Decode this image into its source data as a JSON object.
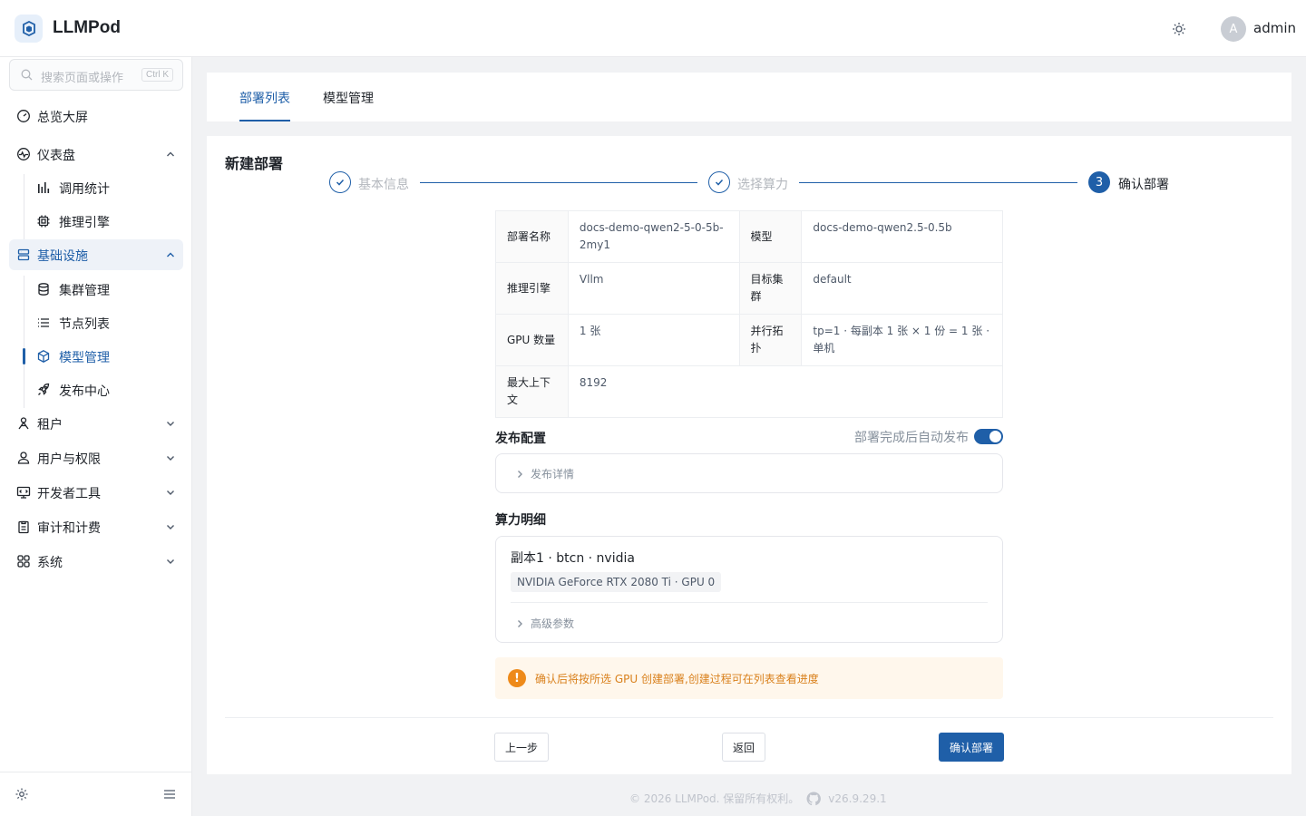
{
  "app": {
    "name": "LLMPod"
  },
  "header": {
    "username": "admin",
    "avatar_letter": "A"
  },
  "sidebar": {
    "search_placeholder": "搜索页面或操作",
    "search_shortcut": "Ctrl K",
    "items": [
      {
        "label": "总览大屏",
        "icon": "dashboard-gauge-icon"
      },
      {
        "label": "仪表盘",
        "icon": "pulse-icon",
        "expanded": true,
        "children": [
          {
            "label": "调用统计",
            "icon": "bar-chart-icon"
          },
          {
            "label": "推理引擎",
            "icon": "chip-icon"
          }
        ]
      },
      {
        "label": "基础设施",
        "icon": "server-icon",
        "expanded": true,
        "active": true,
        "children": [
          {
            "label": "集群管理",
            "icon": "database-icon"
          },
          {
            "label": "节点列表",
            "icon": "list-icon"
          },
          {
            "label": "模型管理",
            "icon": "cube-icon",
            "active": true
          },
          {
            "label": "发布中心",
            "icon": "rocket-icon"
          }
        ]
      },
      {
        "label": "租户",
        "icon": "tenant-icon"
      },
      {
        "label": "用户与权限",
        "icon": "user-icon"
      },
      {
        "label": "开发者工具",
        "icon": "code-window-icon"
      },
      {
        "label": "审计和计费",
        "icon": "clipboard-icon"
      },
      {
        "label": "系统",
        "icon": "apps-grid-icon"
      }
    ]
  },
  "tabs": [
    {
      "label": "部署列表",
      "active": true
    },
    {
      "label": "模型管理",
      "active": false
    }
  ],
  "page": {
    "title": "新建部署"
  },
  "steps": [
    {
      "label": "基本信息",
      "status": "done"
    },
    {
      "label": "选择算力",
      "status": "done"
    },
    {
      "label": "确认部署",
      "status": "current",
      "number": "3"
    }
  ],
  "summary": {
    "deploy_name_label": "部署名称",
    "deploy_name": "docs-demo-qwen2-5-0-5b-2my1",
    "model_label": "模型",
    "model": "docs-demo-qwen2.5-0.5b",
    "engine_label": "推理引擎",
    "engine": "Vllm",
    "cluster_label": "目标集群",
    "cluster": "default",
    "gpu_count_label": "GPU 数量",
    "gpu_count": "1 张",
    "topology_label": "并行拓扑",
    "topology": "tp=1 · 每副本 1 张 × 1 份 = 1 张 · 单机",
    "max_context_label": "最大上下文",
    "max_context": "8192"
  },
  "publish": {
    "title": "发布配置",
    "auto_publish_label": "部署完成后自动发布",
    "auto_publish": true,
    "details_label": "发布详情"
  },
  "compute": {
    "title": "算力明细",
    "replica": "副本1 · btcn · nvidia",
    "gpu_tag": "NVIDIA GeForce RTX 2080 Ti · GPU 0",
    "advanced_label": "高级参数"
  },
  "alert": {
    "text": "确认后将按所选 GPU 创建部署,创建过程可在列表查看进度"
  },
  "buttons": {
    "prev": "上一步",
    "back": "返回",
    "confirm": "确认部署"
  },
  "footer": {
    "copyright": "© 2026 LLMPod. 保留所有权利。",
    "version": "v26.9.29.1"
  },
  "colors": {
    "primary": "#1f5fa8",
    "warning": "#ee8a1a"
  }
}
